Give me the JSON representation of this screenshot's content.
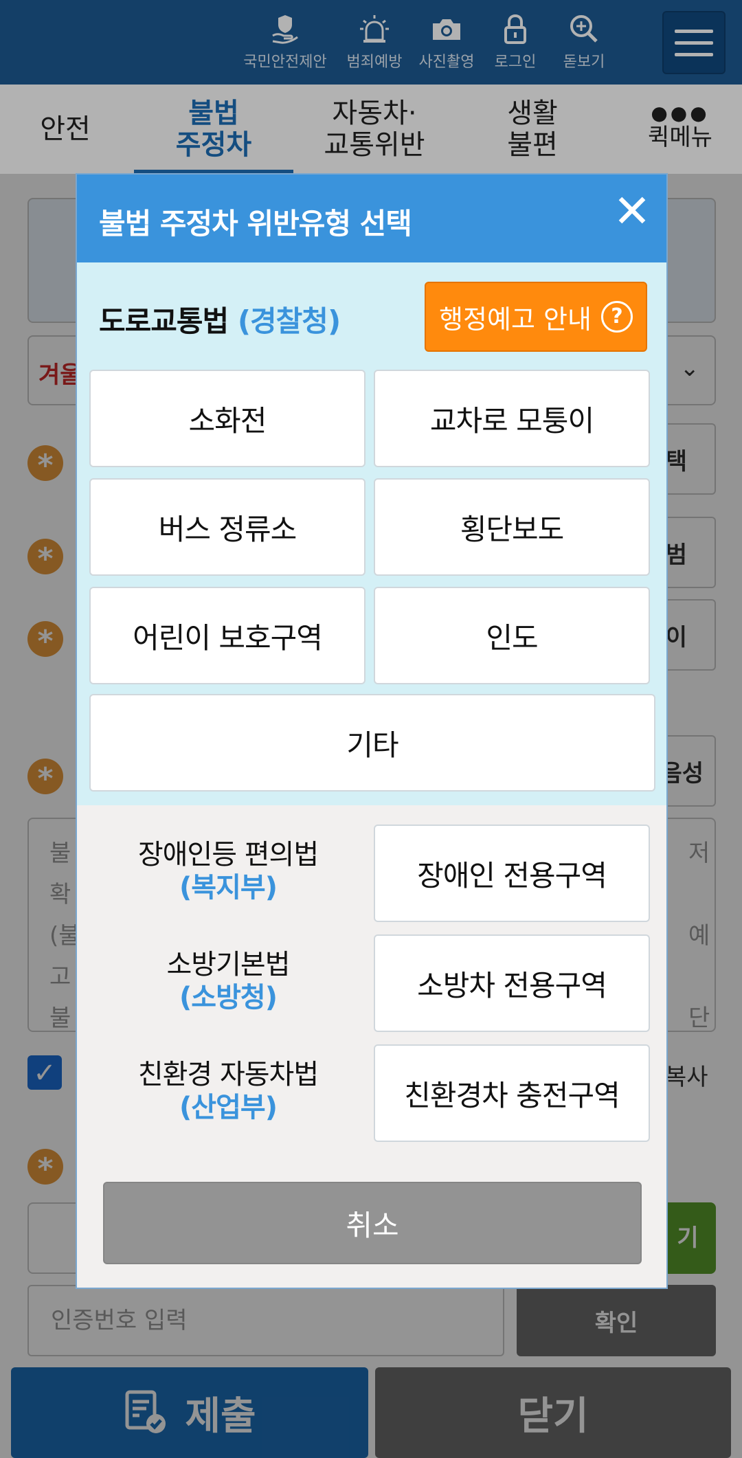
{
  "topbar": {
    "icons": [
      {
        "label": "국민안전제안",
        "icon": "hand-shield-icon"
      },
      {
        "label": "범죄예방",
        "icon": "siren-icon"
      },
      {
        "label": "사진촬영",
        "icon": "camera-icon"
      },
      {
        "label": "로그인",
        "icon": "lock-icon"
      },
      {
        "label": "돋보기",
        "icon": "magnifier-icon"
      }
    ],
    "menu_icon": "hamburger-menu-icon"
  },
  "tabs": [
    {
      "label": "안전",
      "active": false
    },
    {
      "label": "불법\n주정차",
      "active": true
    },
    {
      "label": "자동차·\n교통위반",
      "active": false
    },
    {
      "label": "생활\n불편",
      "active": false
    },
    {
      "label": "퀵메뉴",
      "active": false,
      "icon": "more-dots-icon"
    }
  ],
  "background": {
    "select_text": "겨울",
    "side_buttons": [
      "택",
      "범",
      "이",
      "음성"
    ],
    "textarea_left": [
      "불",
      "확",
      "(불",
      "고",
      "불"
    ],
    "textarea_right": [
      "저",
      "",
      "예",
      "",
      "단"
    ],
    "copy_label": "복사",
    "green_button": "기",
    "cert_placeholder": "인증번호 입력",
    "confirm": "확인",
    "submit": "제출",
    "close": "닫기"
  },
  "modal": {
    "title": "불법 주정차 위반유형 선택",
    "close_icon": "close-x-icon",
    "police": {
      "law": "도로교통법",
      "agency": "(경찰청)",
      "notice_button": "행정예고 안내",
      "notice_icon": "question-circle-icon",
      "types": [
        "소화전",
        "교차로 모퉁이",
        "버스 정류소",
        "횡단보도",
        "어린이 보호구역",
        "인도",
        "기타"
      ]
    },
    "other_laws": [
      {
        "law": "장애인등 편의법",
        "agency": "(복지부)",
        "zone": "장애인 전용구역"
      },
      {
        "law": "소방기본법",
        "agency": "(소방청)",
        "zone": "소방차 전용구역"
      },
      {
        "law": "친환경 자동차법",
        "agency": "(산업부)",
        "zone": "친환경차 충전구역"
      }
    ],
    "cancel": "취소"
  },
  "colors": {
    "topbar": "#1d5b94",
    "modal_header": "#3a93dc",
    "police_section": "#d4f0f6",
    "notice_button": "#ff8a0d",
    "agency_text": "#3a93dc",
    "cancel_button": "#939393"
  }
}
